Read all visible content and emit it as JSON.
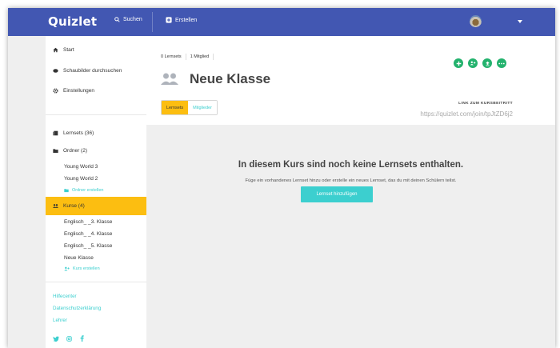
{
  "topbar": {
    "logo": "Quizlet",
    "search_label": "Suchen",
    "create_label": "Erstellen"
  },
  "sidebar": {
    "nav": [
      {
        "label": "Start",
        "icon": "home-icon"
      },
      {
        "label": "Schaubilder durchsuchen",
        "icon": "diagram-icon"
      },
      {
        "label": "Einstellungen",
        "icon": "gear-icon"
      }
    ],
    "sets_label": "Lernsets (36)",
    "folders_label": "Ordner (2)",
    "folders": [
      "Young World 3",
      "Young World 2"
    ],
    "create_folder": "Ordner erstellen",
    "courses_label": "Kurse (4)",
    "courses": [
      "Englisch_ _3. Klasse",
      "Englisch_ _4. Klasse",
      "Englisch_ _5. Klasse",
      "Neue Klasse"
    ],
    "create_course": "Kurs erstellen",
    "footer_links": [
      "Hilfecenter",
      "Datenschutzerklärung",
      "Lehrer"
    ],
    "social": [
      "twitter-icon",
      "instagram-icon",
      "facebook-icon"
    ]
  },
  "class": {
    "sets_count": "0 Lernsets",
    "members_count": "1 Mitglied",
    "title": "Neue Klasse",
    "tabs": [
      "Lernsets",
      "Mitglieder"
    ],
    "join_link_label": "LINK ZUM KURSBEITRITT",
    "join_link_url": "https://quizlet.com/join/tpJtZD6j2",
    "actions": [
      "add-icon",
      "add-member-icon",
      "upload-icon",
      "more-icon"
    ]
  },
  "empty_state": {
    "title": "In diesem Kurs sind noch keine Lernsets enthalten.",
    "subtitle": "Füge ein vorhandenes Lernset hinzu oder erstelle ein neues Lernset, das du mit deinen Schülern teilst.",
    "button": "Lernset hinzufügen"
  },
  "colors": {
    "topbar": "#4257b2",
    "accent_yellow": "#fcbe11",
    "accent_teal": "#3ccfcf",
    "action_green": "#23b26d",
    "background": "#efefef"
  }
}
